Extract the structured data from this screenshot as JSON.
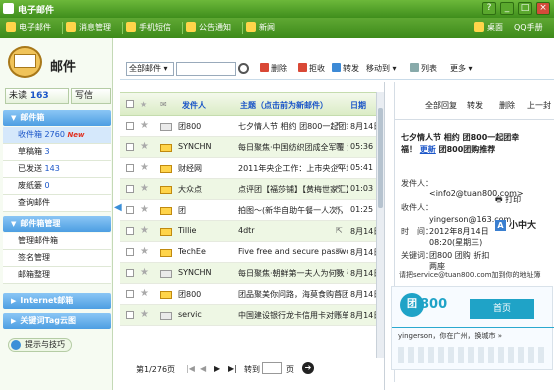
{
  "titlebar": {
    "title": "电子邮件",
    "btn_help": "?",
    "btn_min": "_",
    "btn_max": "□",
    "btn_close": "×"
  },
  "topnav": {
    "items": [
      "电子邮件",
      "消息管理",
      "手机短信",
      "公告通知",
      "新闻"
    ],
    "right_items": [
      "桌面",
      "QQ手册"
    ]
  },
  "sidebar": {
    "title": "邮件",
    "unread_label": "未读",
    "unread_count": "163",
    "compose_label": "写信",
    "group_mailbox": "邮件箱",
    "folders": [
      {
        "label": "收件箱",
        "count": "2760",
        "badge": "New"
      },
      {
        "label": "草稿箱",
        "count": "3",
        "badge": ""
      },
      {
        "label": "已发送",
        "count": "143",
        "badge": ""
      },
      {
        "label": "废纸篓",
        "count": "0",
        "badge": ""
      },
      {
        "label": "查询邮件",
        "count": "",
        "badge": ""
      }
    ],
    "group_manage": "邮件箱管理",
    "manage_items": [
      "管理邮件箱",
      "签名管理",
      "邮箱整理"
    ],
    "group_internet": "Internet邮箱",
    "group_keyword": "关键词Tag云图",
    "tips": "提示与技巧"
  },
  "toolbar": {
    "select_value": "全部邮件",
    "search_placeholder": "",
    "delete": "删除",
    "reject": "拒收",
    "forward": "转发",
    "move": "移动到",
    "list": "列表",
    "more": "更多"
  },
  "list": {
    "col_sender": "发件人",
    "col_subject": "主题（点击前为新邮件）",
    "col_date": "日期",
    "rows": [
      {
        "sender": "团800",
        "subject": "七夕情人节 相约 团800一起团幸",
        "date": "8月14日",
        "read": true
      },
      {
        "sender": "SYNCHN",
        "subject": "每日聚焦·中国纺织团成全军覆 没",
        "date": "05:36",
        "read": false
      },
      {
        "sender": "财经网",
        "subject": "2011年央企工作：上市央企平均工",
        "date": "05:41",
        "read": false
      },
      {
        "sender": "大众点",
        "subject": "点评团【福莎铺】【黄梅世家汇】",
        "date": "01:03",
        "read": false
      },
      {
        "sender": "团",
        "subject": "拍图～(新华自助午餐一人次)，【",
        "date": "01:25",
        "read": false
      },
      {
        "sender": "Tillie",
        "subject": "4dtr",
        "date": "8月14日",
        "read": false
      },
      {
        "sender": "TechEe",
        "subject": "Five free and secure password",
        "date": "8月14日",
        "read": false
      },
      {
        "sender": "SYNCHN",
        "subject": "每日聚焦·朝鲜第一夫人为何数 强",
        "date": "8月14日",
        "read": true
      },
      {
        "sender": "团800",
        "subject": "团品聚美你问路，海莫食购首团",
        "date": "8月14日",
        "read": false
      },
      {
        "sender": "servic",
        "subject": "中国建设银行龙卡信用卡对账单",
        "date": "8月14日",
        "read": true
      }
    ]
  },
  "pager": {
    "info": "第1/276页",
    "goto": "转到",
    "page_suffix": "页"
  },
  "preview": {
    "tools": [
      "全部回复",
      "转发",
      "删除",
      "上一封"
    ],
    "subject": "七夕情人节 相约 团800一起团幸福！",
    "subject_link": "更新",
    "subject_tail": "团800团购推荐",
    "from_label": "发件人：",
    "from_value": "<info2@tuan800.com>",
    "to_label": "收件人：",
    "to_value": "yingerson@163.com",
    "time_label": "时　间：",
    "time_value": "2012年8月14日 08:20(星期三)",
    "kw_label": "关键词：",
    "kw_value": "团800 团购 折扣 两座",
    "print_label": "打印",
    "size_label": "小中大",
    "note": "请把service@tuan800.com加到你的地址簿",
    "banner_brand": "800",
    "banner_home": "首页",
    "banner_info": "yingerson，你在广州，换城市 »"
  },
  "colors": {
    "brand_green": "#4f9e25",
    "link_blue": "#1a55c8",
    "accent_blue": "#4d9ee2"
  }
}
